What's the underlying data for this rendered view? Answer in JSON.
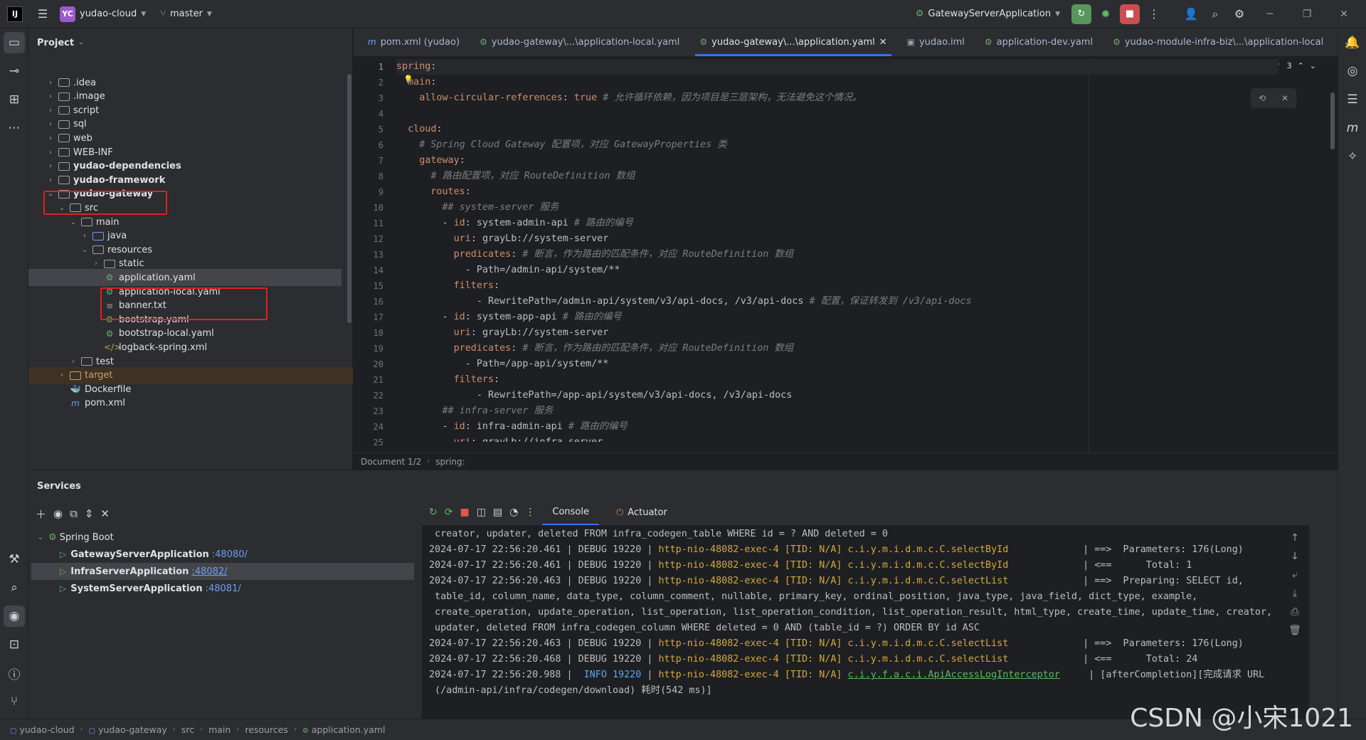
{
  "titlebar": {
    "project_badge": "YC",
    "project_name": "yudao-cloud",
    "branch": "master",
    "run_config": "GatewayServerApplication"
  },
  "project_panel": {
    "title": "Project",
    "tree": [
      {
        "label": ".idea",
        "kind": "folder",
        "chev": "›"
      },
      {
        "label": ".image",
        "kind": "folder",
        "chev": "›"
      },
      {
        "label": "script",
        "kind": "folder",
        "chev": "›"
      },
      {
        "label": "sql",
        "kind": "folder",
        "chev": "›"
      },
      {
        "label": "web",
        "kind": "folder",
        "chev": "›"
      },
      {
        "label": "WEB-INF",
        "kind": "folder",
        "chev": "›"
      },
      {
        "label": "yudao-dependencies",
        "kind": "module",
        "chev": "›"
      },
      {
        "label": "yudao-framework",
        "kind": "module",
        "chev": "›"
      },
      {
        "label": "yudao-gateway",
        "kind": "module",
        "chev": "⌄"
      },
      {
        "label": "src",
        "kind": "folder",
        "chev": "⌄"
      },
      {
        "label": "main",
        "kind": "folder",
        "chev": "⌄"
      },
      {
        "label": "java",
        "kind": "blue-folder",
        "chev": "›"
      },
      {
        "label": "resources",
        "kind": "res-folder",
        "chev": "⌄"
      },
      {
        "label": "static",
        "kind": "folder",
        "chev": "›"
      },
      {
        "label": "application.yaml",
        "kind": "yaml",
        "chev": ""
      },
      {
        "label": "application-local.yaml",
        "kind": "yaml",
        "chev": ""
      },
      {
        "label": "banner.txt",
        "kind": "txt",
        "chev": ""
      },
      {
        "label": "bootstrap.yaml",
        "kind": "yaml",
        "chev": ""
      },
      {
        "label": "bootstrap-local.yaml",
        "kind": "yaml",
        "chev": ""
      },
      {
        "label": "logback-spring.xml",
        "kind": "xml",
        "chev": ""
      },
      {
        "label": "test",
        "kind": "folder",
        "chev": "›"
      },
      {
        "label": "target",
        "kind": "orange-folder",
        "chev": "›"
      },
      {
        "label": "Dockerfile",
        "kind": "docker",
        "chev": ""
      },
      {
        "label": "pom.xml",
        "kind": "maven",
        "chev": ""
      }
    ]
  },
  "editor": {
    "tabs": [
      {
        "label": "pom.xml (yudao)",
        "icon": "m"
      },
      {
        "label": "yudao-gateway\\...\\application-local.yaml",
        "icon": "y"
      },
      {
        "label": "yudao-gateway\\...\\application.yaml",
        "icon": "y",
        "active": true
      },
      {
        "label": "yudao.iml",
        "icon": "i"
      },
      {
        "label": "application-dev.yaml",
        "icon": "y"
      },
      {
        "label": "yudao-module-infra-biz\\...\\application-local",
        "icon": "y"
      }
    ],
    "inspections": {
      "warnings": "1",
      "ok": "3"
    },
    "breadcrumb": {
      "doc": "Document 1/2",
      "path": "spring:"
    },
    "lines": [
      {
        "n": "1",
        "indent": "",
        "key": "spring",
        "colon": ":",
        "val": "",
        "comment": ""
      },
      {
        "n": "2",
        "indent": "  ",
        "key": "main",
        "colon": ":",
        "val": "",
        "comment": ""
      },
      {
        "n": "3",
        "indent": "    ",
        "key": "allow-circular-references",
        "colon": ": ",
        "val": "true",
        "comment": " # 允许循环依赖，因为项目是三层架构，无法避免这个情况。"
      },
      {
        "n": "4",
        "indent": "",
        "key": "",
        "colon": "",
        "val": "",
        "comment": ""
      },
      {
        "n": "5",
        "indent": "  ",
        "key": "cloud",
        "colon": ":",
        "val": "",
        "comment": ""
      },
      {
        "n": "6",
        "indent": "    ",
        "key": "",
        "colon": "",
        "val": "",
        "comment": "# Spring Cloud Gateway 配置项，对应 GatewayProperties 类"
      },
      {
        "n": "7",
        "indent": "    ",
        "key": "gateway",
        "colon": ":",
        "val": "",
        "comment": ""
      },
      {
        "n": "8",
        "indent": "      ",
        "key": "",
        "colon": "",
        "val": "",
        "comment": "# 路由配置项，对应 RouteDefinition 数组"
      },
      {
        "n": "9",
        "indent": "      ",
        "key": "routes",
        "colon": ":",
        "val": "",
        "comment": ""
      },
      {
        "n": "10",
        "indent": "        ",
        "key": "",
        "colon": "",
        "val": "",
        "comment": "## system-server 服务"
      },
      {
        "n": "11",
        "indent": "        ",
        "dash": "- ",
        "key": "id",
        "colon": ": ",
        "val": "system-admin-api",
        "comment": " # 路由的编号"
      },
      {
        "n": "12",
        "indent": "          ",
        "key": "uri",
        "colon": ": ",
        "val": "grayLb://system-server",
        "comment": ""
      },
      {
        "n": "13",
        "indent": "          ",
        "key": "predicates",
        "colon": ":",
        "val": "",
        "comment": " # 断言，作为路由的匹配条件，对应 RouteDefinition 数组"
      },
      {
        "n": "14",
        "indent": "            ",
        "key": "",
        "colon": "",
        "val": "- Path=/admin-api/system/**",
        "comment": ""
      },
      {
        "n": "15",
        "indent": "          ",
        "key": "filters",
        "colon": ":",
        "val": "",
        "comment": ""
      },
      {
        "n": "16",
        "indent": "              ",
        "key": "",
        "colon": "",
        "val": "- RewritePath=/admin-api/system/v3/api-docs, /v3/api-docs",
        "comment": " # 配置，保证转发到 /v3/api-docs"
      },
      {
        "n": "17",
        "indent": "        ",
        "dash": "- ",
        "key": "id",
        "colon": ": ",
        "val": "system-app-api",
        "comment": " # 路由的编号"
      },
      {
        "n": "18",
        "indent": "          ",
        "key": "uri",
        "colon": ": ",
        "val": "grayLb://system-server",
        "comment": ""
      },
      {
        "n": "19",
        "indent": "          ",
        "key": "predicates",
        "colon": ":",
        "val": "",
        "comment": " # 断言，作为路由的匹配条件，对应 RouteDefinition 数组"
      },
      {
        "n": "20",
        "indent": "            ",
        "key": "",
        "colon": "",
        "val": "- Path=/app-api/system/**",
        "comment": ""
      },
      {
        "n": "21",
        "indent": "          ",
        "key": "filters",
        "colon": ":",
        "val": "",
        "comment": ""
      },
      {
        "n": "22",
        "indent": "              ",
        "key": "",
        "colon": "",
        "val": "- RewritePath=/app-api/system/v3/api-docs, /v3/api-docs",
        "comment": ""
      },
      {
        "n": "23",
        "indent": "        ",
        "key": "",
        "colon": "",
        "val": "",
        "comment": "## infra-server 服务"
      },
      {
        "n": "24",
        "indent": "        ",
        "dash": "- ",
        "key": "id",
        "colon": ": ",
        "val": "infra-admin-api",
        "comment": " # 路由的编号"
      },
      {
        "n": "25",
        "indent": "          ",
        "key": "uri",
        "colon": ": ",
        "val": "grayLb://infra-server",
        "comment": ""
      }
    ]
  },
  "services": {
    "title": "Services",
    "tree": [
      {
        "label": "Spring Boot",
        "port": ""
      },
      {
        "label": "GatewayServerApplication",
        "port": ":48080/"
      },
      {
        "label": "InfraServerApplication",
        "port": ":48082/"
      },
      {
        "label": "SystemServerApplication",
        "port": ":48081/"
      }
    ],
    "console_tabs": [
      "Console",
      "Actuator"
    ],
    "log_lines": [
      {
        "plain": " creator, updater, deleted FROM infra_codegen_table WHERE id = ? AND deleted = 0"
      },
      {
        "ts": "2024-07-17 22:56:20.461",
        "lvl": "DEBUG 19220",
        "thr": "http-nio-48082-exec-4",
        "tid": "[TID: N/A]",
        "cls": "c.i.y.m.i.d.m.c.C.selectById",
        "msg": "| ==>  Parameters: 176(Long)"
      },
      {
        "ts": "2024-07-17 22:56:20.461",
        "lvl": "DEBUG 19220",
        "thr": "http-nio-48082-exec-4",
        "tid": "[TID: N/A]",
        "cls": "c.i.y.m.i.d.m.c.C.selectById",
        "msg": "| <==      Total: 1"
      },
      {
        "ts": "2024-07-17 22:56:20.463",
        "lvl": "DEBUG 19220",
        "thr": "http-nio-48082-exec-4",
        "tid": "[TID: N/A]",
        "cls": "c.i.y.m.i.d.m.c.C.selectList",
        "msg": "| ==>  Preparing: SELECT id,"
      },
      {
        "plain": " table_id, column_name, data_type, column_comment, nullable, primary_key, ordinal_position, java_type, java_field, dict_type, example,"
      },
      {
        "plain": " create_operation, update_operation, list_operation, list_operation_condition, list_operation_result, html_type, create_time, update_time, creator,"
      },
      {
        "plain": " updater, deleted FROM infra_codegen_column WHERE deleted = 0 AND (table_id = ?) ORDER BY id ASC"
      },
      {
        "ts": "2024-07-17 22:56:20.463",
        "lvl": "DEBUG 19220",
        "thr": "http-nio-48082-exec-4",
        "tid": "[TID: N/A]",
        "cls": "c.i.y.m.i.d.m.c.C.selectList",
        "msg": "| ==>  Parameters: 176(Long)"
      },
      {
        "ts": "2024-07-17 22:56:20.468",
        "lvl": "DEBUG 19220",
        "thr": "http-nio-48082-exec-4",
        "tid": "[TID: N/A]",
        "cls": "c.i.y.m.i.d.m.c.C.selectList",
        "msg": "| <==      Total: 24"
      },
      {
        "ts": "2024-07-17 22:56:20.988",
        "lvl": " INFO 19220",
        "thr": "http-nio-48082-exec-4",
        "tid": "[TID: N/A]",
        "cls": "c.i.y.f.a.c.i.ApiAccessLogInterceptor",
        "msg": " | [afterCompletion][完成请求 URL"
      },
      {
        "plain": " (/admin-api/infra/codegen/download) 耗时(542 ms)]"
      }
    ]
  },
  "statusbar": {
    "crumbs": [
      "yudao-cloud",
      "yudao-gateway",
      "src",
      "main",
      "resources",
      "application.yaml"
    ]
  },
  "watermark": "CSDN @小宋1021"
}
